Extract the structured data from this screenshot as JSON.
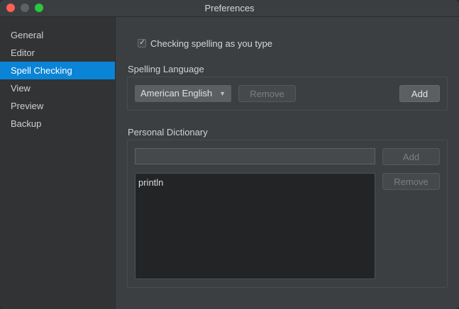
{
  "window": {
    "title": "Preferences"
  },
  "sidebar": {
    "items": [
      {
        "label": "General"
      },
      {
        "label": "Editor"
      },
      {
        "label": "Spell Checking"
      },
      {
        "label": "View"
      },
      {
        "label": "Preview"
      },
      {
        "label": "Backup"
      }
    ],
    "selected": "Spell Checking"
  },
  "spell": {
    "check_as_you_type_label": "Checking spelling as you type",
    "check_as_you_type_checked": true,
    "language_section_label": "Spelling Language",
    "language_selected": "American English",
    "language_remove_label": "Remove",
    "language_add_label": "Add"
  },
  "dictionary": {
    "section_label": "Personal Dictionary",
    "input_value": "",
    "add_label": "Add",
    "remove_label": "Remove",
    "words": [
      "println"
    ]
  },
  "colors": {
    "accent": "#0a84d6",
    "close": "#fe5f57",
    "maximize": "#28c840"
  }
}
